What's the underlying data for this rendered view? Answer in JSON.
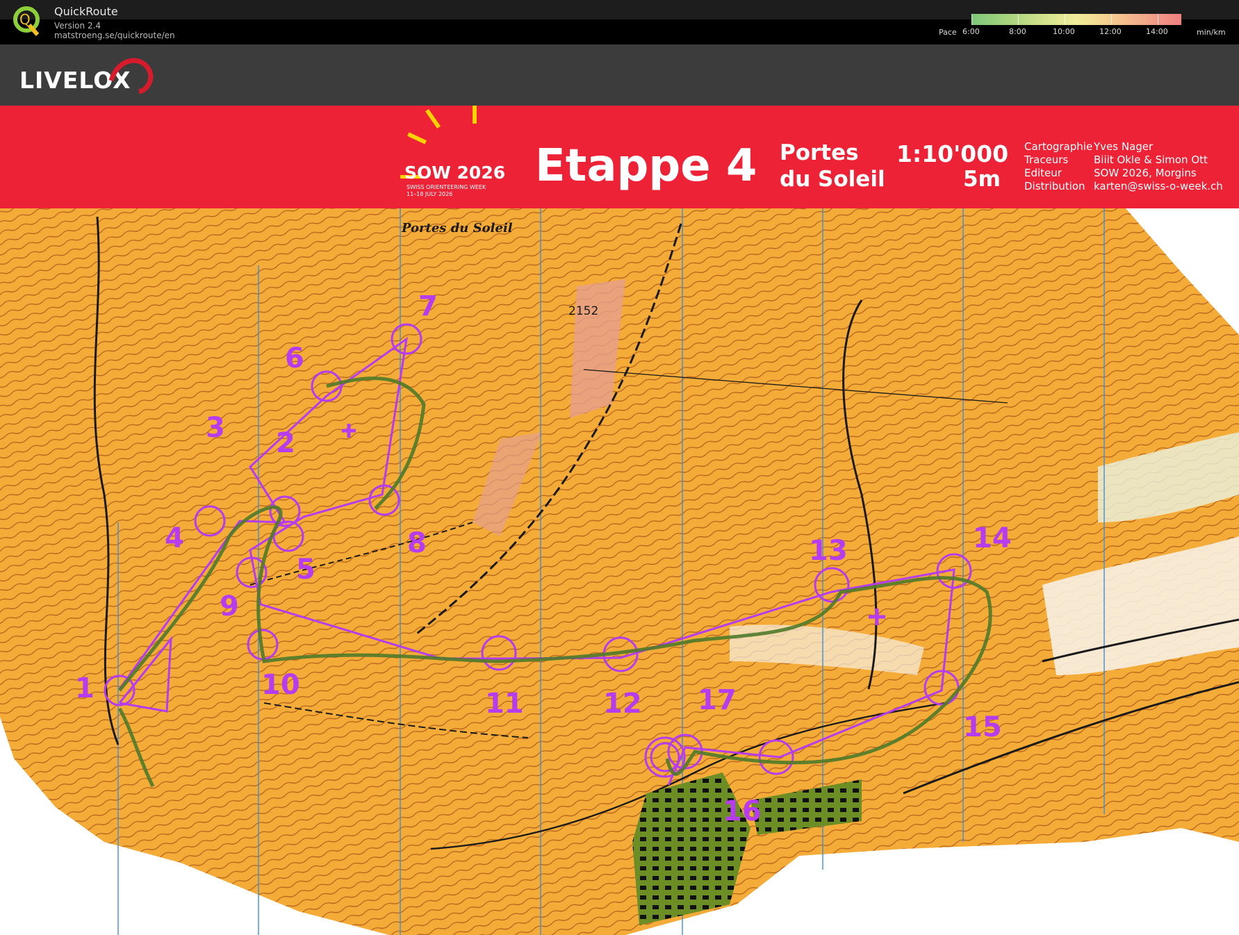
{
  "app": {
    "name": "QuickRoute",
    "version": "Version 2.4",
    "url": "matstroeng.se/quickroute/en"
  },
  "pace_legend": {
    "title": "Pace",
    "ticks": [
      "6:00",
      "8:00",
      "10:00",
      "12:00",
      "14:00"
    ],
    "unit": "min/km",
    "colors": [
      "#7ec87a",
      "#d4e28c",
      "#f0ec9a",
      "#f3a98a",
      "#ef7f7f"
    ]
  },
  "livelox": {
    "logo_text": "LIVELOX"
  },
  "map_header": {
    "event_title": "SOW 2026",
    "event_sub1": "SWISS ORIENTEERING WEEK",
    "event_sub2": "11–18 JULY 2026",
    "stage": "Etappe 4",
    "area_line1": "Portes",
    "area_line2": "du Soleil",
    "scale": "1:10'000",
    "contour": "5m",
    "credits": [
      {
        "key": "Cartographie",
        "value": "Yves Nager"
      },
      {
        "key": "Traceurs",
        "value": "Biiit Okle & Simon Ott"
      },
      {
        "key": "Editeur",
        "value": "SOW 2026, Morgins"
      },
      {
        "key": "Distribution",
        "value": "karten@swiss-o-week.ch"
      }
    ],
    "colors": {
      "band": "#ee2237",
      "sun": "#ffd200"
    }
  },
  "map": {
    "ski_logo": "Portes du Soleil",
    "spot_height": "2152",
    "course_color": "#b73bef",
    "route_color": "#4f7a2a",
    "controls": [
      "1",
      "2",
      "3",
      "4",
      "5",
      "6",
      "7",
      "8",
      "9",
      "10",
      "11",
      "12",
      "13",
      "14",
      "15",
      "16",
      "17"
    ]
  }
}
